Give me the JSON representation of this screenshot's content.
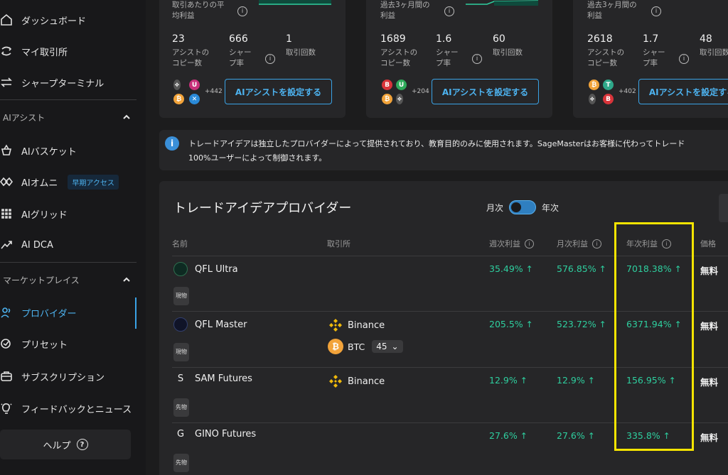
{
  "sidebar": {
    "items": [
      {
        "label": "ダッシュボード",
        "icon": "home-icon"
      },
      {
        "label": "マイ取引所",
        "icon": "exchange-icon"
      },
      {
        "label": "シャープターミナル",
        "icon": "arrows-icon"
      }
    ],
    "ai_section": "AIアシスト",
    "ai_items": [
      {
        "label": "AIバスケット",
        "icon": "basket-icon"
      },
      {
        "label": "AIオムニ",
        "icon": "omni-icon",
        "badge": "早期アクセス"
      },
      {
        "label": "AIグリッド",
        "icon": "grid-icon"
      },
      {
        "label": "AI DCA",
        "icon": "dca-icon"
      }
    ],
    "market_section": "マーケットプレイス",
    "market_items": [
      {
        "label": "プロバイダー",
        "icon": "providers-icon",
        "active": true
      },
      {
        "label": "プリセット",
        "icon": "preset-icon"
      },
      {
        "label": "サブスクリプション",
        "icon": "subscription-icon"
      },
      {
        "label": "フィードバックとニュース",
        "icon": "bulb-icon"
      }
    ],
    "help": "ヘルプ"
  },
  "cards": [
    {
      "caption": [
        "取引あたりの平",
        "均利益"
      ],
      "copies": "23",
      "sharpe": "666",
      "trades": "1",
      "copies_label": [
        "アシストの",
        "コピー数"
      ],
      "sharpe_label": [
        "シャー",
        "プ率"
      ],
      "trades_label": "取引回数",
      "plus": "+442",
      "button": "AIアシストを設定する"
    },
    {
      "caption": [
        "過去3ヶ月間の",
        "利益"
      ],
      "copies": "1689",
      "sharpe": "1.6",
      "trades": "60",
      "copies_label": [
        "アシストの",
        "コピー数"
      ],
      "sharpe_label": [
        "シャー",
        "プ率"
      ],
      "trades_label": "取引回数",
      "plus": "+204",
      "button": "AIアシストを設定する"
    },
    {
      "caption": [
        "過去3ヶ月間の",
        "利益"
      ],
      "copies": "2618",
      "sharpe": "1.7",
      "trades": "48",
      "copies_label": [
        "アシストの",
        "コピー数"
      ],
      "sharpe_label": [
        "シャー",
        "プ率"
      ],
      "trades_label": "取引回数",
      "plus": "+402",
      "button": "AIアシストを設定する"
    }
  ],
  "notice": {
    "line1": "トレードアイデアは独立したプロバイダーによって提供されており、教育目的のみに使用されます。SageMasterはお客様に代わってトレード",
    "line2": "100%ユーザーによって制御されます。"
  },
  "providers": {
    "title": "トレードアイデアプロバイダー",
    "toggle_left": "月次",
    "toggle_right": "年次",
    "columns": {
      "name": "名前",
      "exchange": "取引所",
      "weekly": "週次利益",
      "monthly": "月次利益",
      "yearly": "年次利益",
      "price": "価格"
    },
    "rows": [
      {
        "name": "QFL Ultra",
        "tag": "現物",
        "exchange": "",
        "weekly": "35.49%",
        "monthly": "576.85%",
        "yearly": "7018.38%",
        "price": "無料"
      },
      {
        "name": "QFL Master",
        "tag": "現物",
        "exchange": "Binance",
        "coin": "BTC",
        "coin_count": "45",
        "weekly": "205.5%",
        "monthly": "523.72%",
        "yearly": "6371.94%",
        "price": "無料"
      },
      {
        "name": "SAM Futures",
        "letter": "S",
        "tag": "先物",
        "exchange": "Binance",
        "weekly": "12.9%",
        "monthly": "12.9%",
        "yearly": "156.95%",
        "price": "無料"
      },
      {
        "name": "GINO Futures",
        "letter": "G",
        "tag": "先物",
        "exchange": "",
        "weekly": "27.6%",
        "monthly": "27.6%",
        "yearly": "335.8%",
        "price": "無料"
      }
    ],
    "arrow": "↑"
  },
  "colors": {
    "accent": "#3aa3e6",
    "profit": "#2ecf9f",
    "highlight": "#f5e400"
  }
}
